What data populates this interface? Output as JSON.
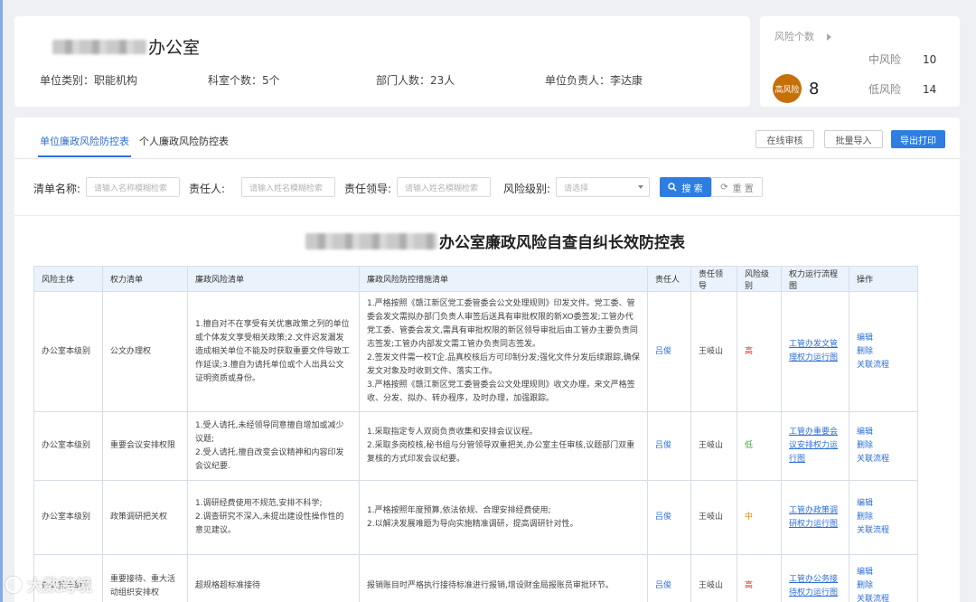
{
  "header": {
    "unit_name": "办公室",
    "unit_type": "单位类别：职能机构",
    "dept_count": "科室个数：5个",
    "staff_count": "部门人数：23人",
    "leader": "单位负责人：李达康"
  },
  "risk_summary": {
    "title": "风险个数",
    "high_label": "高风险",
    "high_count": "8",
    "mid_label": "中风险",
    "mid_count": "10",
    "low_label": "低风险",
    "low_count": "14"
  },
  "tabs": [
    "单位廉政风险防控表",
    "个人廉政风险防控表"
  ],
  "toolbar": {
    "online_review": "在线审核",
    "batch_import": "批量导入",
    "export_print": "导出打印"
  },
  "filters": {
    "list_name_label": "清单名称:",
    "list_name_placeholder": "请输入名称模糊检索",
    "owner_label": "责任人:",
    "owner_placeholder": "请输入姓名模糊检索",
    "leader_label": "责任领导:",
    "leader_placeholder": "请输入姓名模糊检索",
    "level_label": "风险级别:",
    "level_placeholder": "请选择",
    "search": "搜 索",
    "reset": "重 置"
  },
  "table": {
    "title": "办公室廉政风险自查自纠长效防控表",
    "headers": [
      "风险主体",
      "权力清单",
      "廉政风险清单",
      "廉政风险防控措施清单",
      "责任人",
      "责任领导",
      "风险级别",
      "权力运行流程图",
      "操作"
    ],
    "ops": [
      "编辑",
      "删除",
      "关联流程"
    ],
    "rows": [
      {
        "subject": "办公室本级别",
        "power": "公文办理权",
        "risk": "1.擅自对不在享受有关优惠政策之列的单位或个体发文享受相关政策;2.文件迟发漏发造成相关单位不能及时获取重要文件导致工作延误;3.擅自为请托单位或个人出具公文证明资质或身份。",
        "measures": "1.严格按照《赣江新区党工委管委会公文处理规则》印发文件。党工委、管委会发文需拟办部门负责人审签后送具有审批权限的新XO委签发;工管办代党工委、管委会发文,需具有审批权限的新区领导审批后由工管办主要负责同志签发;工管办内部发文需工管办负责同志签发。\n2.签发文件需一校T企.品真校核后方可印制分发;强化文件分发后续跟踪,确保发文对象及时收到文件、落实工作。\n3.严格按照《赣江新区党工委管委会公文处理规则》收文办理，来文严格签收、分发、拟办、转办程序，及时办理，加强跟踪。",
        "owner": "吕俊",
        "leader": "王岐山",
        "level": "高",
        "level_class": "lv-high",
        "flow": "工管办发文管理权力运行图"
      },
      {
        "subject": "办公室本级别",
        "power": "重要会议安排权限",
        "risk": "1.受人请托,未经领导同意擅自增加或减少议题;\n2.受人请托,擅自改变会议精神和内容印发会议纪要.",
        "measures": "1.采取指定专人双岗负责收集和安排会议议程。\n2.采取多岗校核,秘书组与分管领导双重把关,办公室主任审核,议题部门双重复核的方式印发会议纪要。",
        "owner": "吕俊",
        "leader": "王岐山",
        "level": "低",
        "level_class": "lv-low",
        "flow": "工管办重要会议安排权力运行图"
      },
      {
        "subject": "办公室本级别",
        "power": "政策调研把关权",
        "risk": "1.调研经费使用不规范,安排不科学;\n2.调查研究不深入,未提出建设性操作性的意见建议。",
        "measures": "1.严格按照年度预算,依法依规、合理安排经费使用;\n2.以解决发展难题为导向实施精准调研，提高调研针对性。",
        "owner": "吕俊",
        "leader": "王岐山",
        "level": "中",
        "level_class": "lv-mid",
        "flow": "工管办政策调研权力运行图"
      },
      {
        "subject": "办公室本级别",
        "power": "重要接待、重大活动组织安排权",
        "risk": "超规格超标准接待",
        "measures": "报销账目时严格执行接待标准进行报销,增设财金局报账员审批环节。",
        "owner": "吕俊",
        "leader": "王岐山",
        "level": "高",
        "level_class": "lv-high",
        "flow": "工管办公务接待权力运行图"
      }
    ]
  },
  "watermark": "大数跨境"
}
